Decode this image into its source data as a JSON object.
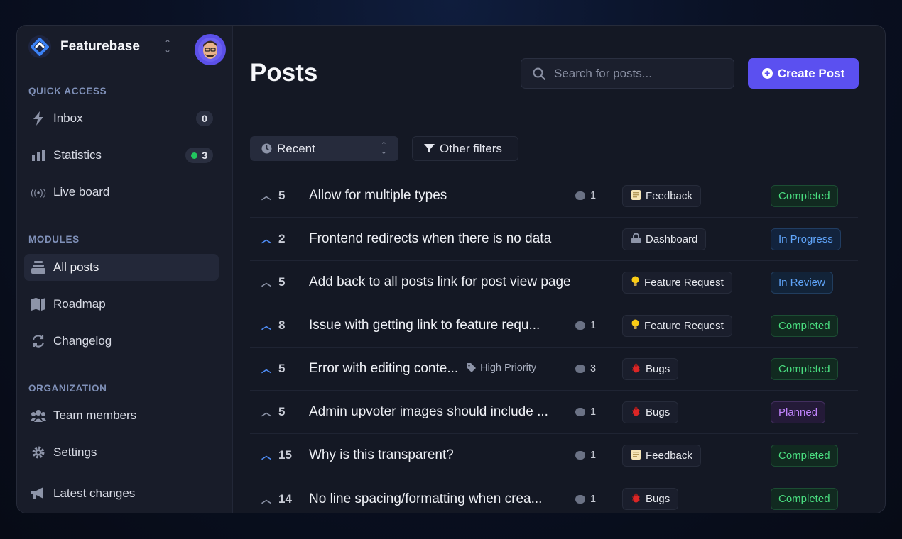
{
  "sidebar": {
    "brand": "Featurebase",
    "sections": {
      "quick_access": "QUICK ACCESS",
      "modules": "MODULES",
      "organization": "ORGANIZATION"
    },
    "quick_access": [
      {
        "label": "Inbox",
        "badge": "0",
        "icon": "lightning-icon"
      },
      {
        "label": "Statistics",
        "badge": "3",
        "icon": "bar-chart-icon"
      },
      {
        "label": "Live board",
        "icon": "broadcast-icon"
      }
    ],
    "modules": [
      {
        "label": "All posts",
        "icon": "stack-icon",
        "active": true
      },
      {
        "label": "Roadmap",
        "icon": "map-icon"
      },
      {
        "label": "Changelog",
        "icon": "refresh-icon"
      }
    ],
    "organization": [
      {
        "label": "Team members",
        "icon": "users-icon"
      },
      {
        "label": "Settings",
        "icon": "gear-icon"
      },
      {
        "label": "Latest changes",
        "icon": "megaphone-icon"
      }
    ]
  },
  "main": {
    "title": "Posts",
    "search_placeholder": "Search for posts...",
    "create_label": "Create Post",
    "sort_label": "Recent",
    "filters_label": "Other filters"
  },
  "posts": [
    {
      "votes": "5",
      "upvoted": false,
      "title": "Allow for multiple types",
      "comments": "1",
      "board": "Feedback",
      "board_icon": "note-icon",
      "status": "Completed"
    },
    {
      "votes": "2",
      "upvoted": true,
      "title": "Frontend redirects when there is no data",
      "comments": "",
      "board": "Dashboard",
      "board_icon": "lock-icon",
      "status": "In Progress"
    },
    {
      "votes": "5",
      "upvoted": false,
      "title": "Add back to all posts link for post view page",
      "comments": "",
      "board": "Feature Request",
      "board_icon": "lightbulb-icon",
      "status": "In Review"
    },
    {
      "votes": "8",
      "upvoted": true,
      "title": "Issue with getting link to feature requ...",
      "comments": "1",
      "board": "Feature Request",
      "board_icon": "lightbulb-icon",
      "status": "Completed"
    },
    {
      "votes": "5",
      "upvoted": true,
      "title": "Error with editing conte...",
      "tag": "High Priority",
      "comments": "3",
      "board": "Bugs",
      "board_icon": "bug-icon",
      "status": "Completed"
    },
    {
      "votes": "5",
      "upvoted": false,
      "title": "Admin upvoter images should include ...",
      "comments": "1",
      "board": "Bugs",
      "board_icon": "bug-icon",
      "status": "Planned"
    },
    {
      "votes": "15",
      "upvoted": true,
      "title": "Why is this transparent?",
      "comments": "1",
      "board": "Feedback",
      "board_icon": "note-icon",
      "status": "Completed"
    },
    {
      "votes": "14",
      "upvoted": false,
      "title": "No line spacing/formatting when crea...",
      "comments": "1",
      "board": "Bugs",
      "board_icon": "bug-icon",
      "status": "Completed"
    }
  ],
  "colors": {
    "accent": "#5b50f0",
    "completed_text": "#4ade80",
    "completed_bg": "#112a20",
    "progress_text": "#60a5fa",
    "progress_bg": "#12233d",
    "review_text": "#60a5fa",
    "review_bg": "#122338",
    "planned_text": "#c084fc",
    "planned_bg": "#241a38"
  }
}
